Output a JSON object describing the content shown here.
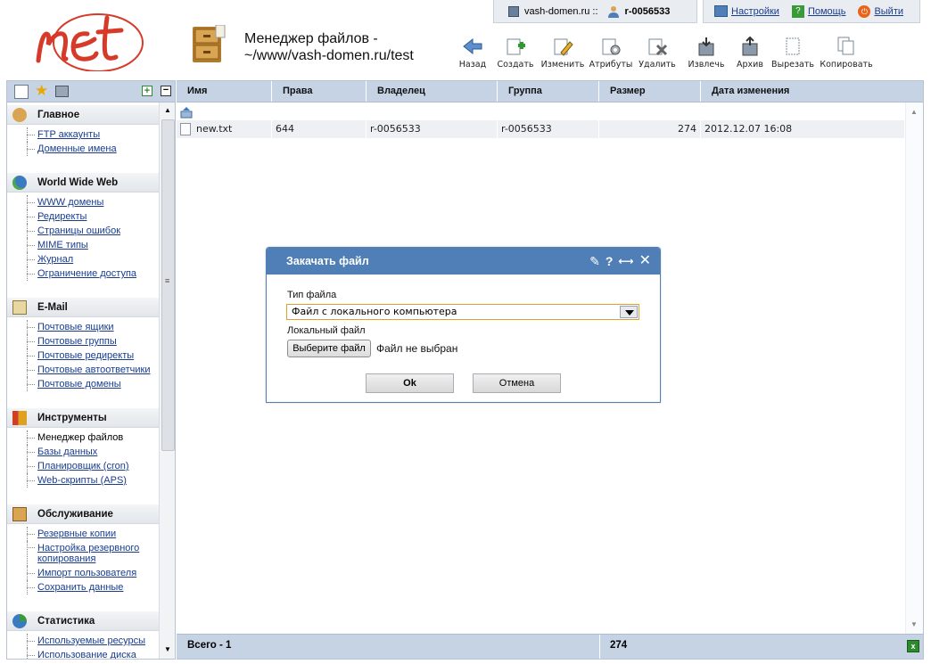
{
  "header": {
    "title_line1": "Менеджер файлов -",
    "title_line2": "~/www/vash-domen.ru/test",
    "domain": "vash-domen.ru ::",
    "user": "r-0056533",
    "links": [
      {
        "label": "Настройки",
        "icon": "settings-icon"
      },
      {
        "label": "Помощь",
        "icon": "help-icon"
      },
      {
        "label": "Выйти",
        "icon": "power-icon"
      }
    ]
  },
  "toolbar": [
    {
      "label": "Назад",
      "icon": "back-arrow-icon"
    },
    {
      "label": "Создать",
      "icon": "create-icon"
    },
    {
      "label": "Изменить",
      "icon": "edit-icon"
    },
    {
      "label": "Атрибуты",
      "icon": "attributes-icon"
    },
    {
      "label": "Удалить",
      "icon": "delete-icon"
    },
    {
      "label": "Извлечь",
      "icon": "extract-icon"
    },
    {
      "label": "Архив",
      "icon": "archive-icon"
    },
    {
      "label": "Вырезать",
      "icon": "cut-icon"
    },
    {
      "label": "Копировать",
      "icon": "copy-icon"
    }
  ],
  "sidebar": [
    {
      "title": "Главное",
      "items": [
        "FTP аккаунты",
        "Доменные имена"
      ]
    },
    {
      "title": "World Wide Web",
      "items": [
        "WWW домены",
        "Редиректы",
        "Страницы ошибок",
        "MIME типы",
        "Журнал",
        "Ограничение доступа"
      ]
    },
    {
      "title": "E-Mail",
      "items": [
        "Почтовые ящики",
        "Почтовые группы",
        "Почтовые редиректы",
        "Почтовые автоответчики",
        "Почтовые домены"
      ]
    },
    {
      "title": "Инструменты",
      "items": [
        "Менеджер файлов",
        "Базы данных",
        "Планировщик (cron)",
        "Web-скрипты (APS)"
      ]
    },
    {
      "title": "Обслуживание",
      "items": [
        "Резервные копии",
        "Настройка резервного копирования",
        "Импорт пользователя",
        "Сохранить данные"
      ]
    },
    {
      "title": "Статистика",
      "items": [
        "Используемые ресурсы",
        "Использование диска"
      ]
    }
  ],
  "table": {
    "columns": [
      "Имя",
      "Права",
      "Владелец",
      "Группа",
      "Размер",
      "Дата изменения"
    ],
    "rows": [
      {
        "name": "new.txt",
        "perms": "644",
        "owner": "r-0056533",
        "group": "r-0056533",
        "size": "274",
        "date": "2012.12.07 16:08"
      }
    ],
    "footer_total": "Всего - 1",
    "footer_size": "274"
  },
  "dialog": {
    "title": "Закачать файл",
    "type_label": "Тип файла",
    "type_value": "Файл с локального компьютера",
    "file_label": "Локальный файл",
    "choose_button": "Выберите файл",
    "no_file": "Файл не выбран",
    "ok": "Ok",
    "cancel": "Отмена"
  },
  "colors": {
    "accent": "#4f7fb6",
    "header_bg": "#c5d3e5",
    "link": "#1a3c8c",
    "logo": "#d63b2a"
  }
}
